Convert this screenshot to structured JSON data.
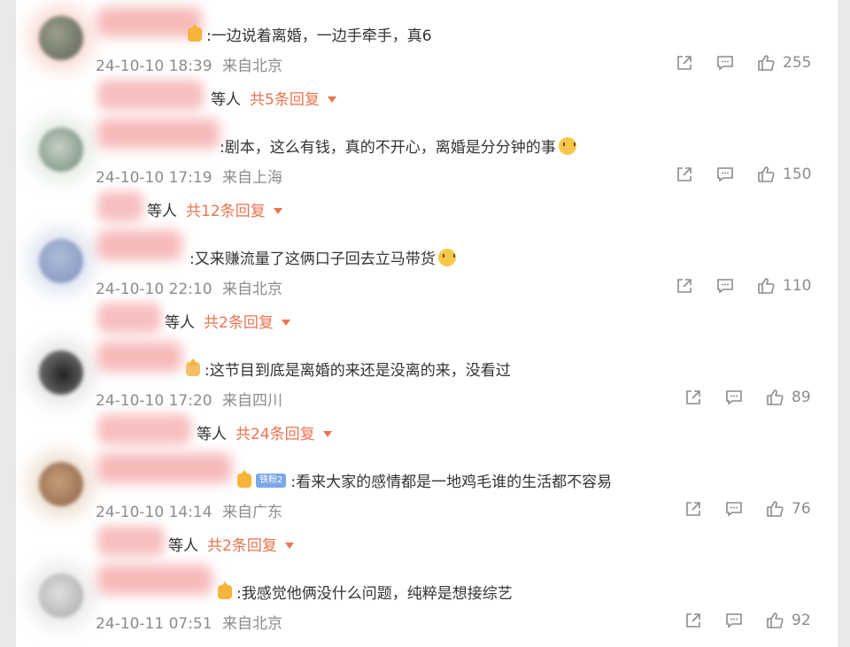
{
  "colors": {
    "accent": "#eb7350",
    "text": "#333333",
    "meta": "#8c8c8c"
  },
  "comments": [
    {
      "text": ":一边说着离婚，一边手牵手，真6",
      "time": "24-10-10 18:39",
      "location": "来自北京",
      "likes": "255",
      "replies_suffix": "等人",
      "replies_link": "共5条回复",
      "icons": [
        "crown-icon"
      ]
    },
    {
      "text": ":剧本，这么有钱，真的不开心，离婚是分分钟的事",
      "time": "24-10-10 17:19",
      "location": "来自上海",
      "likes": "150",
      "replies_suffix": "等人",
      "replies_link": "共12条回复",
      "icons": [
        "cat-emoji-icon"
      ]
    },
    {
      "text": ":又来赚流量了这俩口子回去立马带货",
      "time": "24-10-10 22:10",
      "location": "来自北京",
      "likes": "110",
      "replies_suffix": "等人",
      "replies_link": "共2条回复",
      "icons": [
        "smile-emoji-icon"
      ]
    },
    {
      "text": ":这节目到底是离婚的来还是没离的来，没看过",
      "time": "24-10-10 17:20",
      "location": "来自四川",
      "likes": "89",
      "replies_suffix": "等人",
      "replies_link": "共24条回复",
      "icons": [
        "badge-icon"
      ]
    },
    {
      "text": ":看来大家的感情都是一地鸡毛谁的生活都不容易",
      "time": "24-10-10 14:14",
      "location": "来自广东",
      "likes": "76",
      "replies_suffix": "等人",
      "replies_link": "共2条回复",
      "badge": "铁粉2",
      "icons": [
        "crown-icon"
      ]
    },
    {
      "text": ":我感觉他俩没什么问题，纯粹是想接综艺",
      "time": "24-10-11 07:51",
      "location": "来自北京",
      "likes": "92",
      "icons": [
        "crown-icon"
      ]
    }
  ],
  "action_icons": [
    "share-icon",
    "comment-icon",
    "like-icon"
  ]
}
